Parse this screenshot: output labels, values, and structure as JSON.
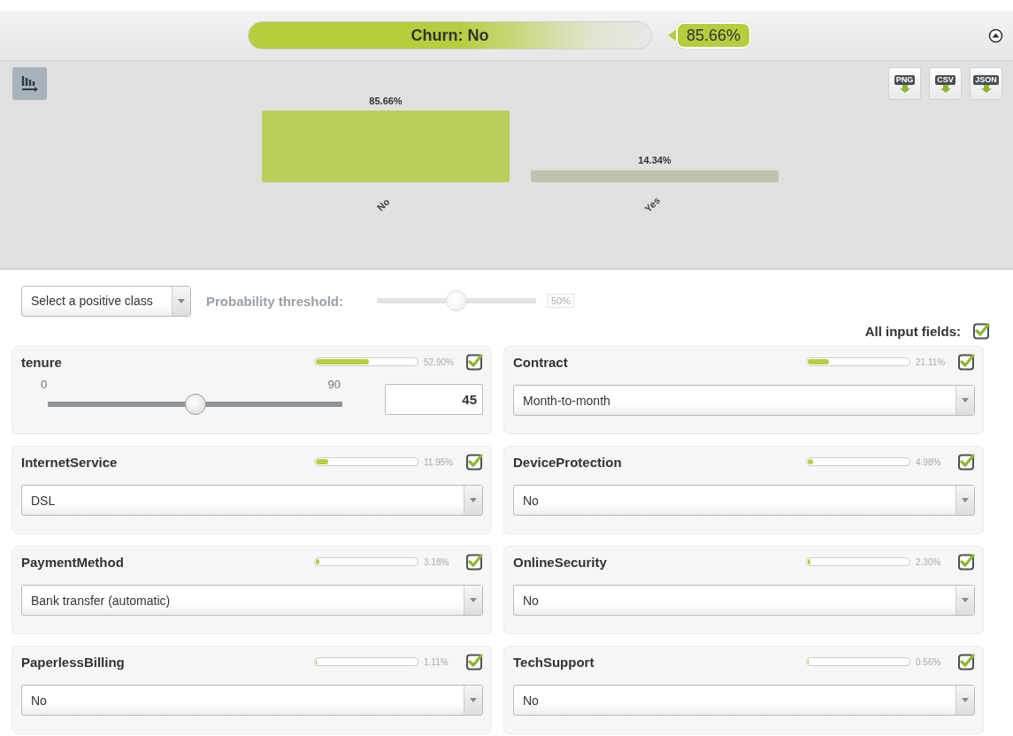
{
  "prediction": {
    "label": "Churn: No",
    "confidence": "85.66%"
  },
  "chart_data": {
    "type": "bar",
    "categories": [
      "No",
      "Yes"
    ],
    "values": [
      85.66,
      14.34
    ],
    "value_labels": [
      "85.66%",
      "14.34%"
    ]
  },
  "export_buttons": [
    "PNG",
    "CSV",
    "JSON"
  ],
  "positive_class": {
    "placeholder": "Select a positive class"
  },
  "threshold": {
    "label": "Probability threshold:",
    "level": 0.5,
    "reading": "50%",
    "disabled": true
  },
  "all_fields": {
    "label": "All input fields:",
    "checked": true
  },
  "fields": [
    {
      "kind": "slider",
      "name": "tenure",
      "importance": {
        "level": 0.529,
        "reading": "52.90%"
      },
      "checked": true,
      "min": "0",
      "max": "90",
      "slider": {
        "level": 0.5
      },
      "value": "45"
    },
    {
      "kind": "select",
      "name": "Contract",
      "importance": {
        "level": 0.2111,
        "reading": "21.11%"
      },
      "checked": true,
      "value": "Month-to-month"
    },
    {
      "kind": "select",
      "name": "InternetService",
      "importance": {
        "level": 0.1195,
        "reading": "11.95%"
      },
      "checked": true,
      "value": "DSL"
    },
    {
      "kind": "select",
      "name": "DeviceProtection",
      "importance": {
        "level": 0.0498,
        "reading": "4.98%"
      },
      "checked": true,
      "value": "No"
    },
    {
      "kind": "select",
      "name": "PaymentMethod",
      "importance": {
        "level": 0.0318,
        "reading": "3.18%"
      },
      "checked": true,
      "value": "Bank transfer (automatic)"
    },
    {
      "kind": "select",
      "name": "OnlineSecurity",
      "importance": {
        "level": 0.023,
        "reading": "2.30%"
      },
      "checked": true,
      "value": "No"
    },
    {
      "kind": "select",
      "name": "PaperlessBilling",
      "importance": {
        "level": 0.0111,
        "reading": "1.11%"
      },
      "checked": true,
      "value": "No"
    },
    {
      "kind": "select",
      "name": "TechSupport",
      "importance": {
        "level": 0.0056,
        "reading": "0.56%"
      },
      "checked": true,
      "value": "No"
    }
  ]
}
